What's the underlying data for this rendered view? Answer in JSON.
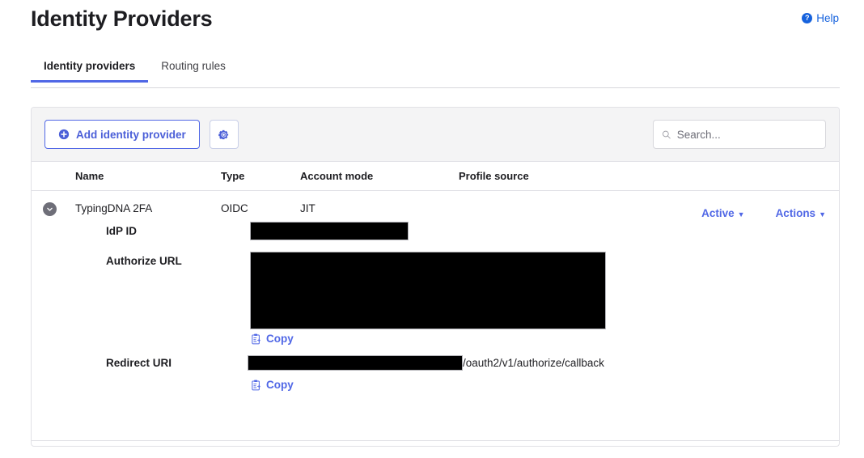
{
  "header": {
    "title": "Identity Providers",
    "help_label": "Help",
    "help_icon": "question-circle-icon"
  },
  "tabs": [
    {
      "label": "Identity providers",
      "active": true
    },
    {
      "label": "Routing rules",
      "active": false
    }
  ],
  "toolbar": {
    "add_button_label": "Add identity provider",
    "add_button_icon": "plus-circle-icon",
    "settings_icon": "gear-icon",
    "search_placeholder": "Search...",
    "search_value": "",
    "search_icon": "search-icon"
  },
  "table": {
    "columns": [
      "Name",
      "Type",
      "Account mode",
      "Profile source"
    ],
    "rows": [
      {
        "expand_icon": "chevron-down-circle-icon",
        "name": "TypingDNA 2FA",
        "type": "OIDC",
        "account_mode": "JIT",
        "profile_source": "",
        "status_label": "Active",
        "actions_label": "Actions",
        "details": [
          {
            "label": "IdP ID",
            "value_redacted": true,
            "value_suffix": "",
            "copy_label": "",
            "redaction_width": 196,
            "redaction_height": 23
          },
          {
            "label": "Authorize URL",
            "value_redacted": true,
            "value_suffix": "",
            "copy_label": "Copy",
            "redaction_width": 440,
            "redaction_height": 96
          },
          {
            "label": "Redirect URI",
            "value_redacted": true,
            "value_suffix": "/oauth2/v1/authorize/callback",
            "copy_label": "Copy",
            "redaction_width": 266,
            "redaction_height": 19
          }
        ]
      }
    ]
  },
  "colors": {
    "accent_blue": "#5067e6",
    "link_blue": "#1662dd",
    "toolbar_bg": "#f4f4f5",
    "border": "#e1e1e6",
    "redaction": "#000000"
  }
}
